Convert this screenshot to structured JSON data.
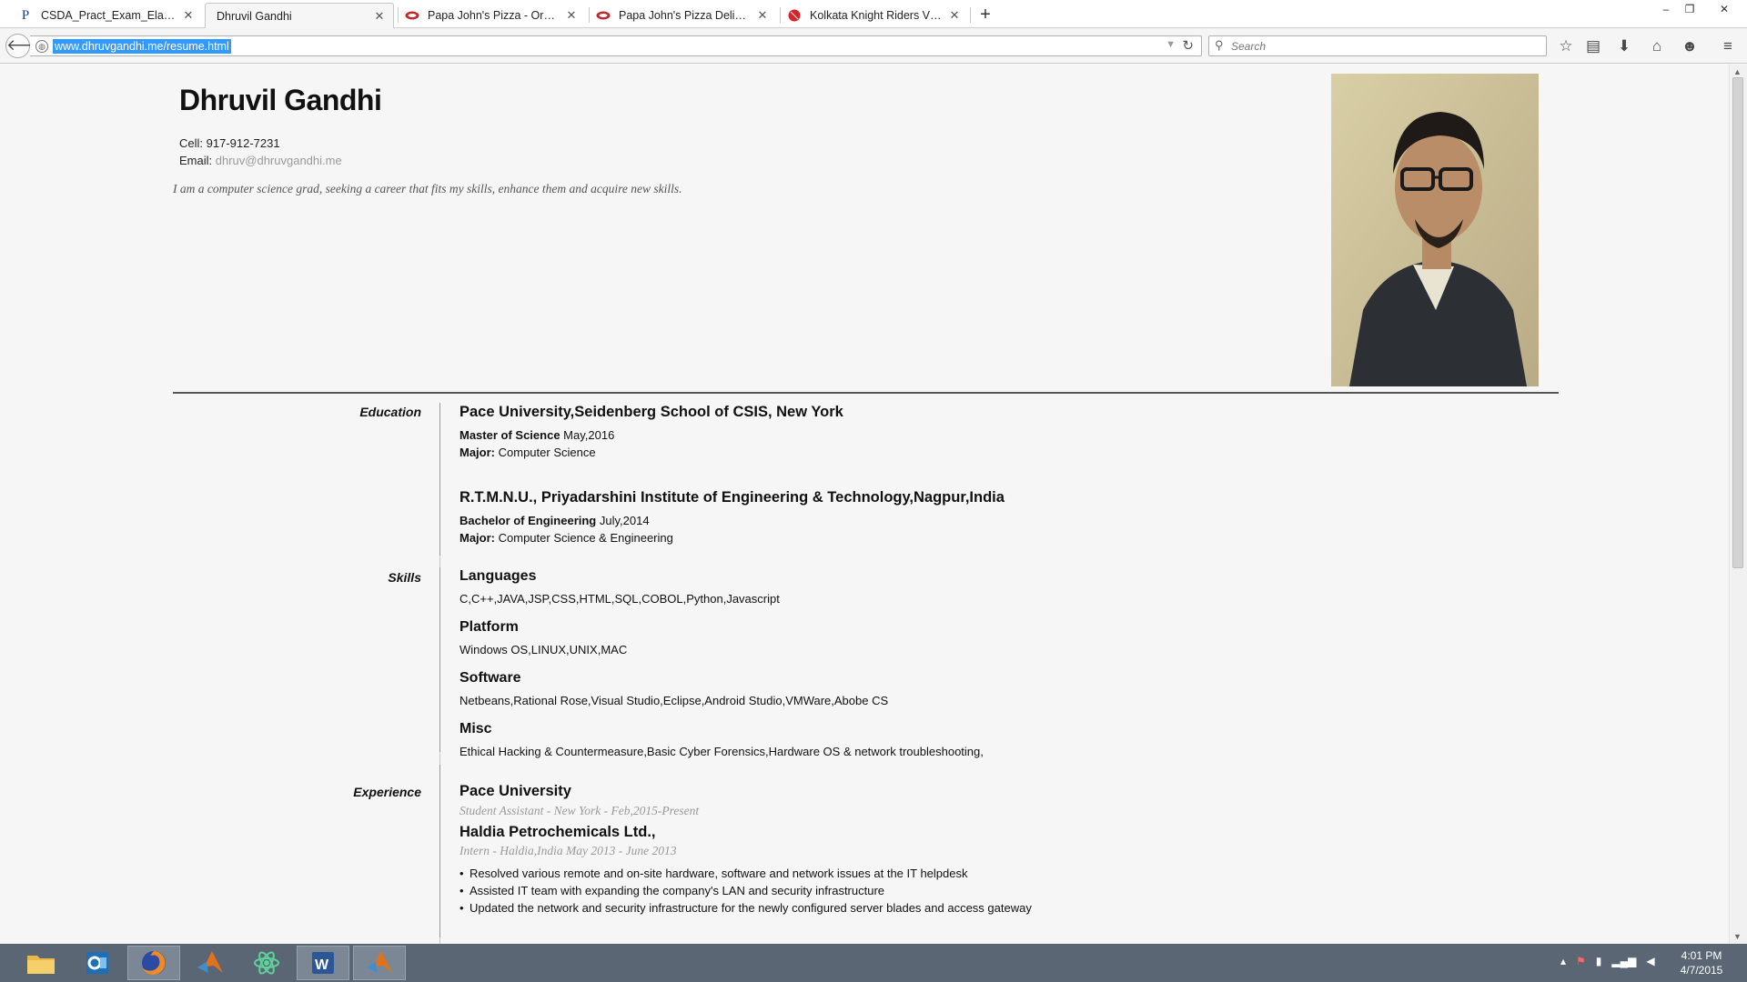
{
  "browser": {
    "tabs": [
      {
        "label": "CSDA_Pract_Exam_Elaborat...",
        "icon": "p-icon"
      },
      {
        "label": "Dhruvil Gandhi",
        "icon": "none",
        "active": true
      },
      {
        "label": "Papa John's Pizza - Order C...",
        "icon": "pizza-icon"
      },
      {
        "label": "Papa John's Pizza Delivery ...",
        "icon": "pizza-icon"
      },
      {
        "label": "Kolkata Knight Riders Vs M...",
        "icon": "cricket-ball-icon"
      }
    ],
    "url": "www.dhruvgandhi.me/resume.html",
    "search_placeholder": "Search"
  },
  "resume": {
    "name": "Dhruvil Gandhi",
    "cell_label": "Cell:",
    "cell": "917-912-7231",
    "email_label": "Email:",
    "email": "dhruv@dhruvgandhi.me",
    "objective": "I am a computer science grad, seeking a career that fits my skills, enhance them and acquire new skills.",
    "education": {
      "heading": "Education",
      "schools": [
        {
          "name": "Pace University,Seidenberg School of CSIS, New York",
          "degree": "Master of Science",
          "date": "May,2016",
          "major_label": "Major:",
          "major": "Computer Science"
        },
        {
          "name": "R.T.M.N.U., Priyadarshini Institute of Engineering & Technology,Nagpur,India",
          "degree": "Bachelor of Engineering",
          "date": "July,2014",
          "major_label": "Major:",
          "major": "Computer Science & Engineering"
        }
      ]
    },
    "skills": {
      "heading": "Skills",
      "groups": [
        {
          "title": "Languages",
          "text": "C,C++,JAVA,JSP,CSS,HTML,SQL,COBOL,Python,Javascript"
        },
        {
          "title": "Platform",
          "text": "Windows OS,LINUX,UNIX,MAC"
        },
        {
          "title": "Software",
          "text": "Netbeans,Rational Rose,Visual Studio,Eclipse,Android Studio,VMWare,Abobe CS"
        },
        {
          "title": "Misc",
          "text": "Ethical Hacking & Countermeasure,Basic Cyber Forensics,Hardware OS & network troubleshooting,"
        }
      ]
    },
    "experience": {
      "heading": "Experience",
      "jobs": [
        {
          "company": "Pace University",
          "meta": "Student Assistant - New York - Feb,2015-Present"
        },
        {
          "company": "Haldia Petrochemicals Ltd.,",
          "meta": "Intern - Haldia,India May 2013 - June 2013",
          "bullets": [
            "Resolved various remote and on-site hardware, software and network issues at the IT helpdesk",
            "Assisted IT team with expanding the company's LAN and security infrastructure",
            "Updated the network and security infrastructure for the newly configured server blades and access gateway"
          ]
        }
      ]
    }
  },
  "taskbar": {
    "apps": [
      "file-explorer-icon",
      "outlook-icon",
      "firefox-icon",
      "matlab-icon",
      "atom-icon",
      "word-icon",
      "matlab-icon"
    ],
    "time": "4:01 PM",
    "date": "4/7/2015"
  }
}
